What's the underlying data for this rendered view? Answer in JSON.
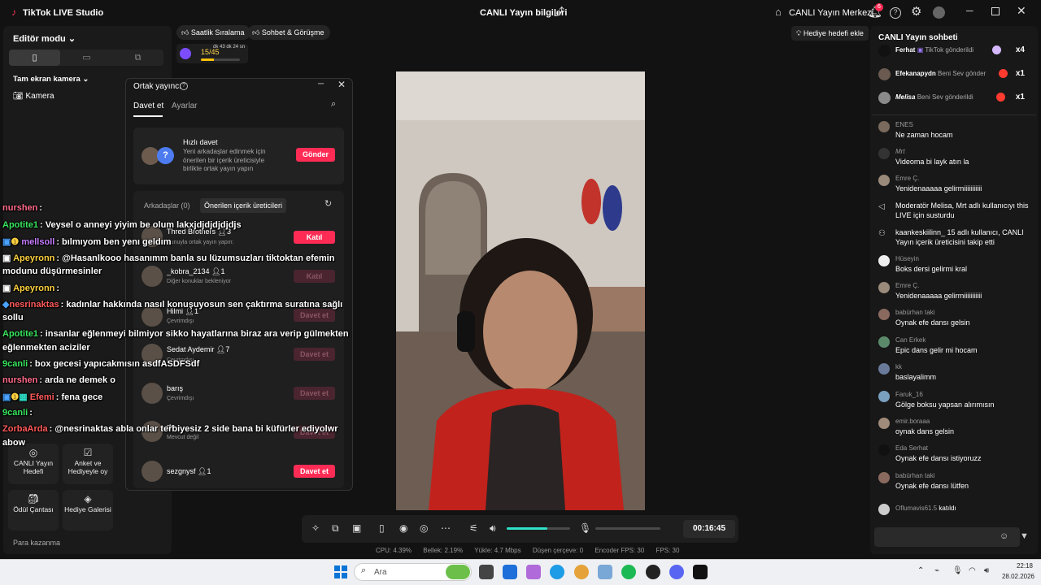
{
  "titlebar": {
    "app_title": "TikTok LIVE Studio",
    "live_info": "CANLI Yayın bilgileri",
    "live_center": "CANLI Yayın Merkezi",
    "notification_count": "6"
  },
  "left_panel": {
    "editor_mode": "Editör modu",
    "fullscreen_camera": "Tam ekran kamera",
    "camera_label": "Kamera",
    "tools": [
      {
        "label": "CANLI Yayın Hedefi",
        "icon": "target-icon"
      },
      {
        "label": "Anket ve Hediyeyle oy",
        "icon": "poll-icon"
      },
      {
        "label": "Ödül Çantası",
        "icon": "reward-bag-icon"
      },
      {
        "label": "Hediye Galerisi",
        "icon": "gift-gallery-icon"
      }
    ],
    "earning": "Para kazanma"
  },
  "top_pills": {
    "hourly_rank": "Saatlik Sıralama",
    "chat_meet": "Sohbet & Görüşme",
    "hourly_count": "15/45",
    "hourly_time": "dk 43 dk 24 sn",
    "hourly_progress": 0.33,
    "gift_goal": "Hediye hedefi ekle"
  },
  "cohost": {
    "title": "Ortak yayıncı",
    "tab_invite": "Davet et",
    "tab_settings": "Ayarlar",
    "quick_invite_title": "Hızlı davet",
    "quick_invite_desc": "Yeni arkadaşlar edinmek için önerilen bir içerik üreticisiyle birlikte ortak yayın yapın",
    "send_label": "Gönder",
    "tab_friends": "Arkadaşlar (0)",
    "tab_suggested": "Önerilen içerik üreticileri",
    "rows": [
      {
        "name": "Thred Brothers",
        "count": "3",
        "sub": "Şunuyla ortak yayın yapın:",
        "button": "Katıl",
        "state": "active"
      },
      {
        "name": "_kobra_2134",
        "count": "1",
        "sub": "Diğer konuklar bekleniyor",
        "button": "Katıl",
        "state": "dim"
      },
      {
        "name": "Hilmi",
        "count": "1",
        "sub": "Çevrimdışı",
        "button": "Davet et",
        "state": "dim"
      },
      {
        "name": "Sedat Aydemir",
        "count": "7",
        "sub": "Çevrimdışı",
        "button": "Davet et",
        "state": "dim"
      },
      {
        "name": "barış",
        "count": "",
        "sub": "Çevrimdışı",
        "button": "Davet et",
        "state": "dim"
      },
      {
        "name": "rte",
        "count": "",
        "sub": "Mevcut değil",
        "button": "Davet et",
        "state": "dim"
      },
      {
        "name": "sezgnysf",
        "count": "1",
        "sub": "",
        "button": "Davet et",
        "state": "active"
      }
    ]
  },
  "overlay_chat": [
    {
      "user": "nurshen",
      "color": "#ff6b8a",
      "text": ":"
    },
    {
      "user": "Apotite1",
      "color": "#39e75f",
      "text": ": Veysel o anneyi yiyim be olum lakxjdjdjdjdjdjs"
    },
    {
      "user": "mellsoll",
      "color": "#c77dff",
      "text": ": bılmıyom ben yenı geldım"
    },
    {
      "user": "Apeyronn",
      "color": "#ffd23f",
      "text": ": @Hasanlkooo hasanımm banla su lüzumsuzları tiktoktan efemin"
    },
    {
      "user": "",
      "color": "#ffffff",
      "text": "modunu düşürmesinler"
    },
    {
      "user": "Apeyronn",
      "color": "#ffd23f",
      "text": ":"
    },
    {
      "user": "nesrinaktas",
      "color": "#ff5a5a",
      "text": ": kadınlar hakkında nasıl konuşuyosun sen çaktırma suratına sağlı"
    },
    {
      "user": "",
      "color": "#ffffff",
      "text": "sollu"
    },
    {
      "user": "Apotite1",
      "color": "#39e75f",
      "text": ": insanlar eğlenmeyi bilmiyor sikko hayatlarına biraz ara verip gülmekten"
    },
    {
      "user": "",
      "color": "#ffffff",
      "text": "eğlenmekten aciziler"
    },
    {
      "user": "9canli",
      "color": "#39e75f",
      "text": ": box gecesi yapıcakmısın asdfASDFSdf"
    },
    {
      "user": "nurshen",
      "color": "#ff6b8a",
      "text": ": arda ne demek o"
    },
    {
      "user": "Efemi",
      "color": "#ff5a5a",
      "text": ": fena gece"
    },
    {
      "user": "9canli",
      "color": "#39e75f",
      "text": ":"
    },
    {
      "user": "ZorbaArda",
      "color": "#ff5a5a",
      "text": ": @nesrinaktas abla onlar terbiyesiz 2 side bana bi küfürler ediyolwr"
    },
    {
      "user": "",
      "color": "#ffffff",
      "text": "abow"
    }
  ],
  "controls": {
    "timer": "00:16:45",
    "volume_level": 0.64
  },
  "stats": {
    "cpu": "CPU: 4.39%",
    "memory": "Bellek: 2.19%",
    "upload": "Yükle: 4.7 Mbps",
    "dropped": "Düşen çerçeve: 0",
    "encoder_fps": "Encoder FPS: 30",
    "fps": "FPS: 30"
  },
  "chat": {
    "title": "CANLI Yayın sohbeti",
    "gifts": [
      {
        "user": "Ferhat",
        "text": "TikTok gönderildi",
        "mult": "x4"
      },
      {
        "user": "Efekanapydn",
        "text": "Beni Sev gönder",
        "mult": "x1"
      },
      {
        "user": "Melisa",
        "text": "Beni Sev gönderildi",
        "mult": "x1"
      }
    ],
    "messages": [
      {
        "user": "ENES",
        "text": "Ne zaman hocam"
      },
      {
        "user": "Mrt",
        "text": "Videoma bi layk atın la"
      },
      {
        "user": "Emre Ç.",
        "text": "Yenidenaaaaa gelirmiiiiiiiiiii"
      },
      {
        "user": "",
        "text": "Moderatör Melisa, Mrt adlı kullanıcıyı this LIVE için susturdu"
      },
      {
        "user": "",
        "text": "kaankeskiilinn_ 15 adlı kullanıcı, CANLI Yayın içerik üreticisini takip etti"
      },
      {
        "user": "Hüseyin",
        "text": "Boks dersi gelirmi kral"
      },
      {
        "user": "Emre Ç.",
        "text": "Yenidenaaaaa gelirmiiiiiiiiiii"
      },
      {
        "user": "babürhan taki",
        "text": "Oynak efe dansı gelsin"
      },
      {
        "user": "Can Erkek",
        "text": "Epic dans gelir mi hocam"
      },
      {
        "user": "kk",
        "text": "baslayalimm"
      },
      {
        "user": "Faruk_16",
        "text": "Gölge boksu yapsan alırımısın"
      },
      {
        "user": "emir.boraaa",
        "text": "oynak dans gelsin"
      },
      {
        "user": "Eda Serhat",
        "text": "Oynak efe dansı istiyoruzz"
      },
      {
        "user": "babürhan taki",
        "text": "Oynak efe dansı lütfen"
      },
      {
        "user": "Oflumavis61.5",
        "text": "katıldı"
      }
    ]
  },
  "taskbar": {
    "search": "Ara",
    "time": "22:18",
    "date": "28.02.2026"
  },
  "colors": {
    "accent": "#fe2c55",
    "volume": "#2fe0c9"
  }
}
